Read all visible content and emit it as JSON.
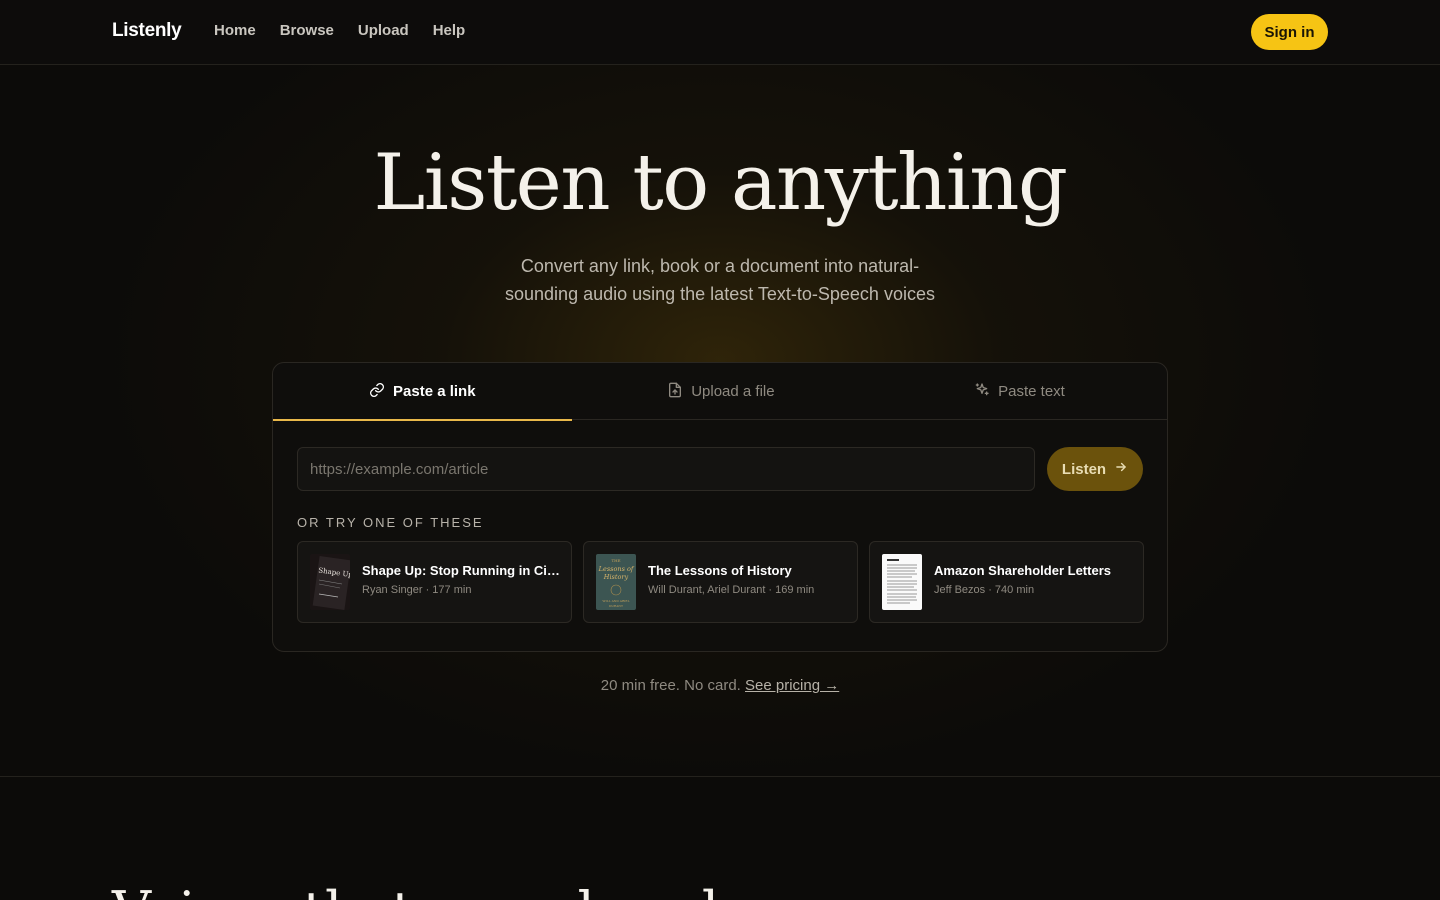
{
  "header": {
    "logo": "Listenly",
    "nav": [
      "Home",
      "Browse",
      "Upload",
      "Help"
    ],
    "signin_label": "Sign in"
  },
  "hero": {
    "title": "Listen to anything",
    "subtitle": "Convert any link, book or a document into natural-sounding audio using the latest Text-to-Speech voices"
  },
  "converter": {
    "tabs": [
      {
        "label": "Paste a link",
        "icon": "link-icon",
        "active": true
      },
      {
        "label": "Upload a file",
        "icon": "file-icon",
        "active": false
      },
      {
        "label": "Paste text",
        "icon": "sparkle-icon",
        "active": false
      }
    ],
    "url_placeholder": "https://example.com/article",
    "url_value": "",
    "listen_label": "Listen",
    "try_label": "OR TRY ONE OF THESE",
    "suggestions": [
      {
        "title": "Shape Up: Stop Running in Circles and Ship Work that Matters",
        "meta": "Ryan Singer · 177 min"
      },
      {
        "title": "The Lessons of History",
        "meta": "Will Durant, Ariel Durant · 169 min"
      },
      {
        "title": "Amazon Shareholder Letters",
        "meta": "Jeff Bezos · 740 min"
      }
    ]
  },
  "pricing": {
    "text": "20 min free. No card.",
    "link": "See pricing →"
  },
  "next_section": {
    "title": "Voices that sound real"
  },
  "colors": {
    "accent": "#f6c414",
    "background": "#0c0b09",
    "tab_underline": "#e9b84a"
  }
}
